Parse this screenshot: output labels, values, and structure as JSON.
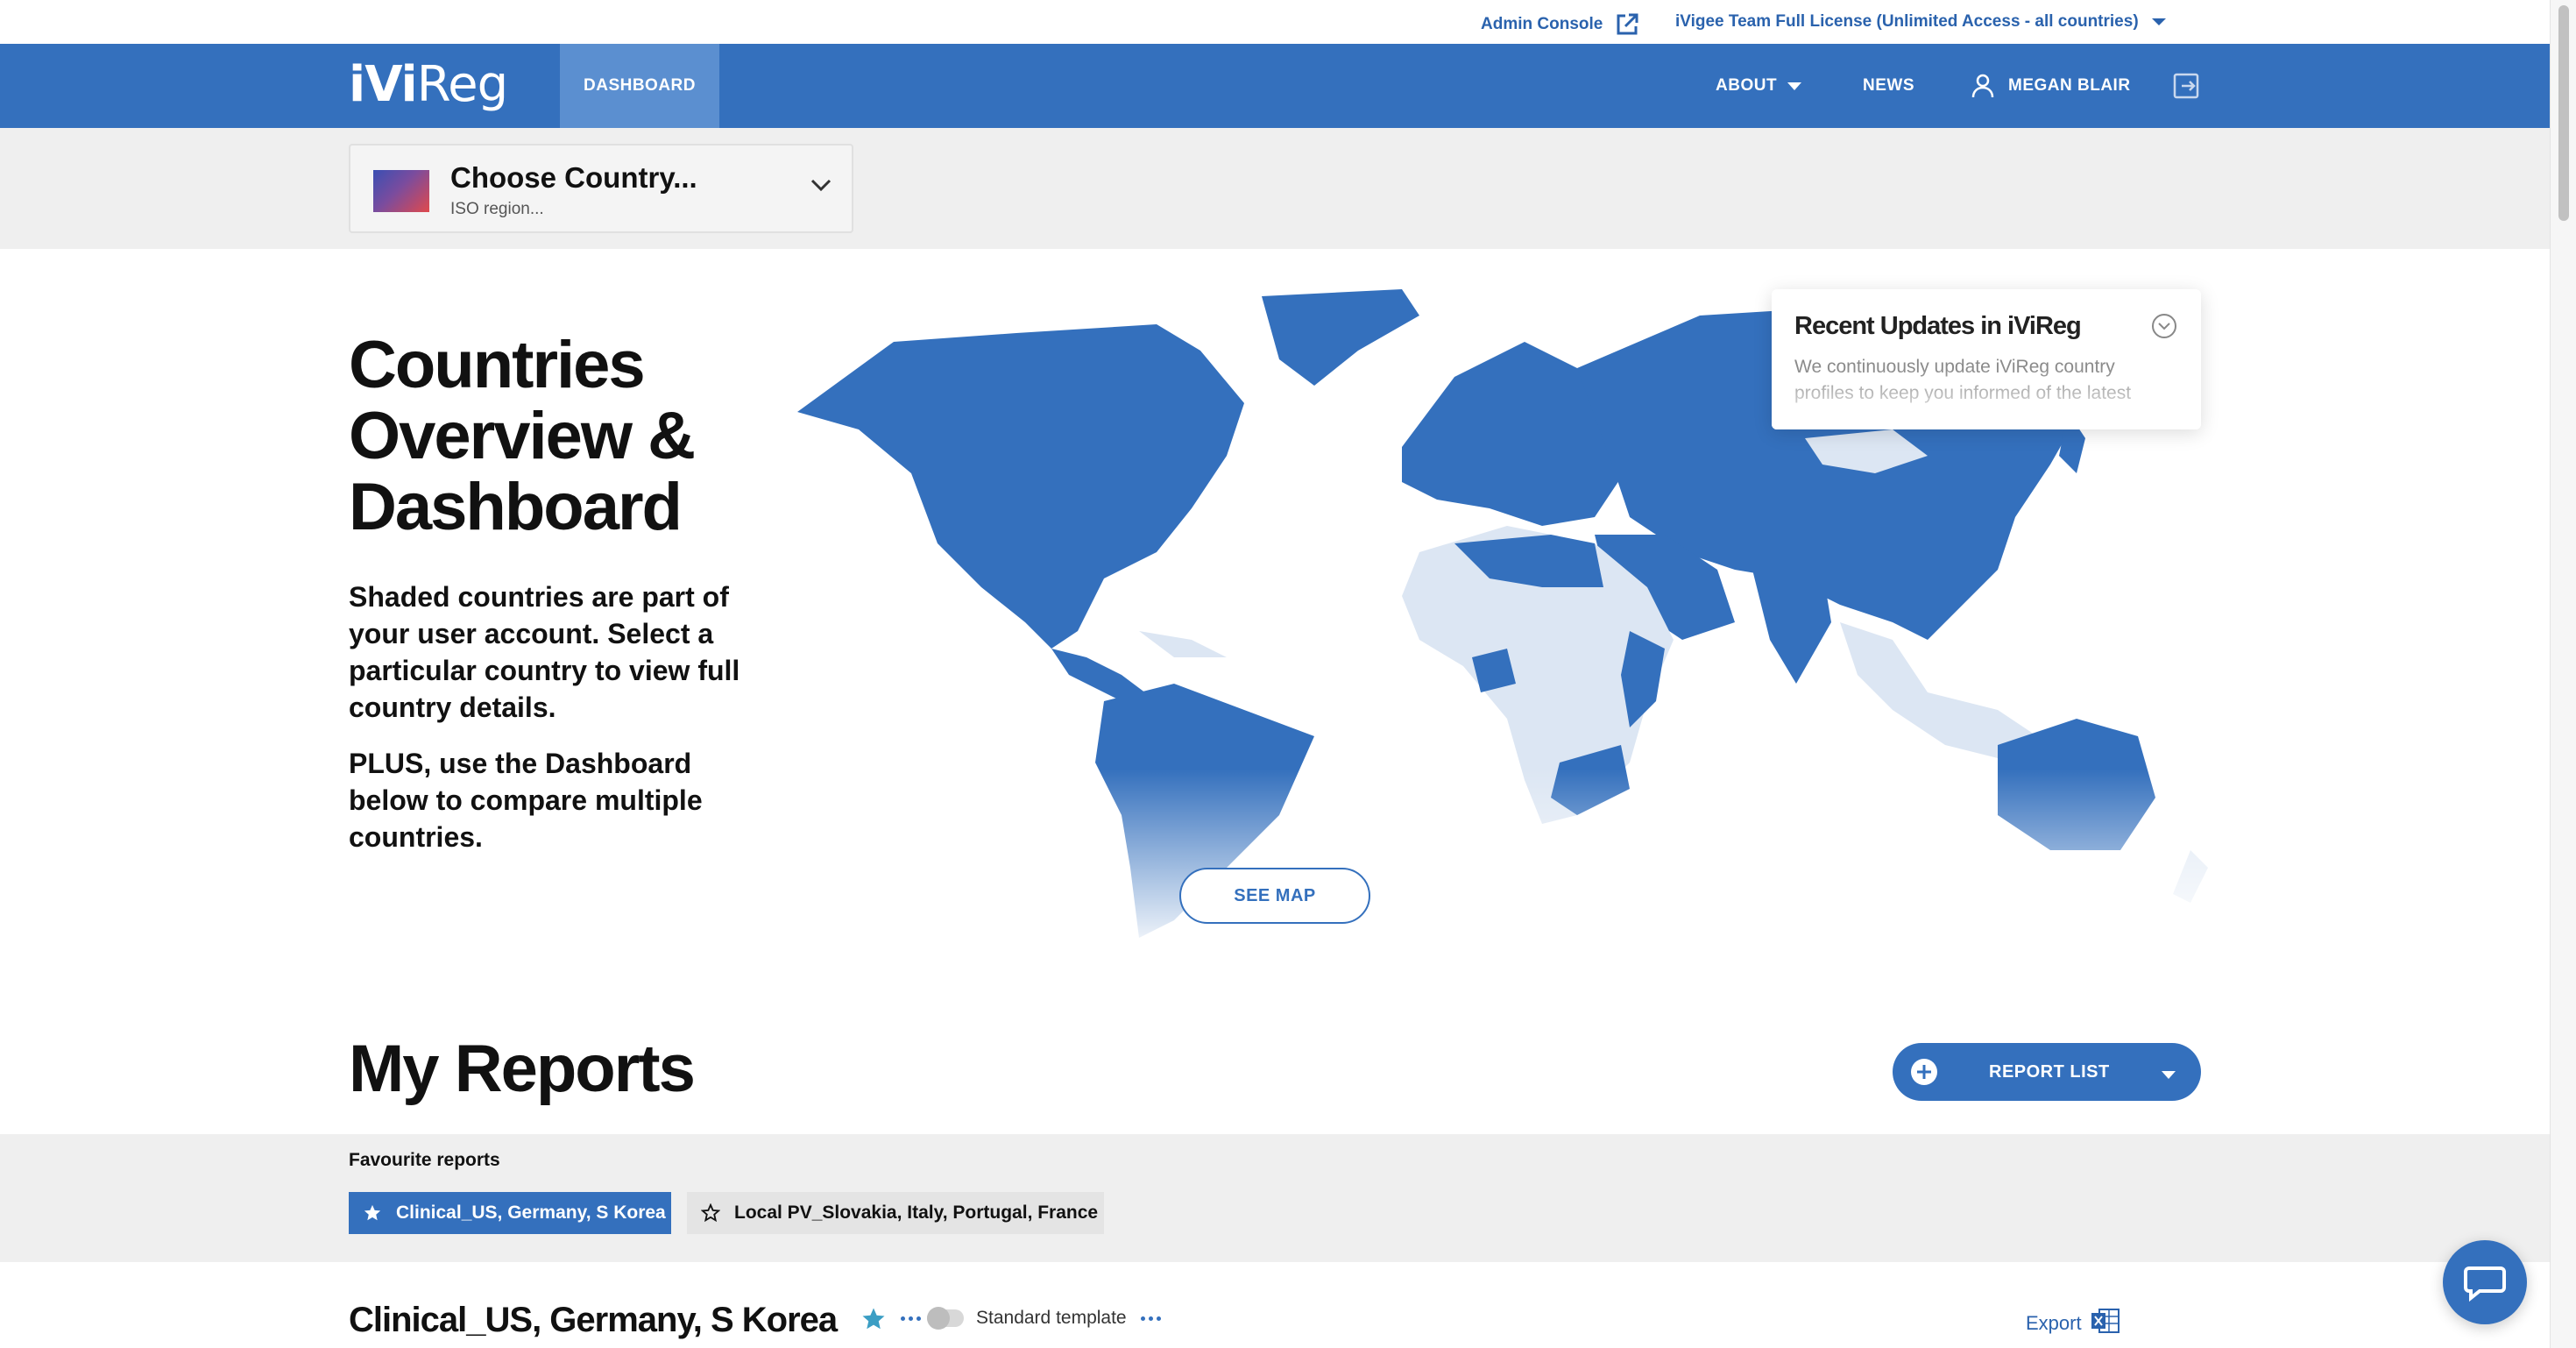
{
  "utility_bar": {
    "admin_console": "Admin Console",
    "license": "iVigee Team Full License (Unlimited Access - all countries)"
  },
  "nav": {
    "logo_ivi": "iVi",
    "logo_reg": "Reg",
    "dashboard": "DASHBOARD",
    "about": "ABOUT",
    "news": "NEWS",
    "user": "MEGAN BLAIR"
  },
  "country_chooser": {
    "title": "Choose Country...",
    "subtitle": "ISO region..."
  },
  "hero": {
    "title": "Countries Overview & Dashboard",
    "text_1": "Shaded countries are part of your user account.  Select a particular country to view full country details.",
    "text_2": "PLUS, use the Dashboard below to compare multiple countries.",
    "see_map": "SEE MAP"
  },
  "recent_updates": {
    "title": "Recent Updates in iViReg",
    "text": "We continuously update iViReg country profiles to keep you informed of the latest"
  },
  "reports": {
    "title": "My Reports",
    "report_list_button": "REPORT LIST",
    "favourites_label": "Favourite reports",
    "favourites": [
      {
        "label": "Clinical_US, Germany, S Korea",
        "active": true
      },
      {
        "label": "Local PV_Slovakia, Italy, Portugal, France",
        "active": false
      }
    ],
    "current": {
      "name": "Clinical_US, Germany, S Korea",
      "template": "Standard template",
      "export": "Export"
    }
  },
  "colors": {
    "brand_blue": "#3470bd",
    "nav_active": "#5b8fd0",
    "map_unshaded": "#dce6f3",
    "link": "#2a62ad"
  },
  "icons": [
    "external-link-icon",
    "chevron-down-icon",
    "user-icon",
    "logout-icon",
    "star-icon",
    "plus-circle-icon",
    "excel-icon",
    "chat-icon"
  ]
}
